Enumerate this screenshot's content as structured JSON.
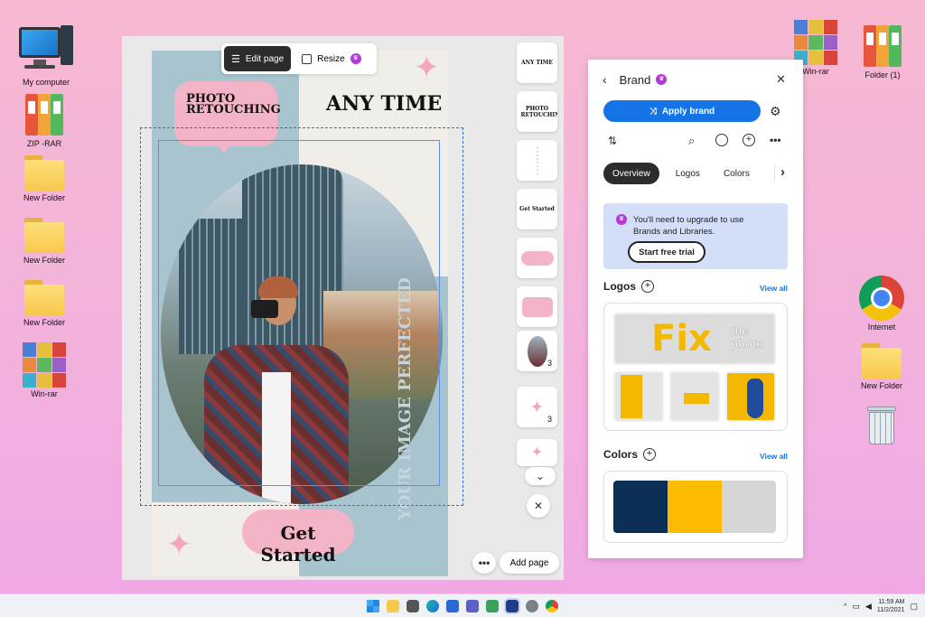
{
  "desktop": {
    "left_icons": [
      {
        "label": "My computer",
        "type": "computer"
      },
      {
        "label": "ZIP -RAR",
        "type": "binders"
      },
      {
        "label": "New Folder",
        "type": "folder"
      },
      {
        "label": "New Folder",
        "type": "folder"
      },
      {
        "label": "New Folder",
        "type": "folder"
      },
      {
        "label": "Win-rar",
        "type": "winrar"
      }
    ],
    "right_icons": [
      {
        "label": "Win-rar",
        "type": "winrar"
      },
      {
        "label": "Folder (1)",
        "type": "binders"
      },
      {
        "label": "Internet",
        "type": "chrome"
      },
      {
        "label": "New Folder",
        "type": "folder"
      },
      {
        "label": "",
        "type": "recycle-bin"
      }
    ]
  },
  "editor": {
    "toolbar": {
      "edit_page": "Edit page",
      "resize": "Resize"
    },
    "canvas": {
      "photo_retouching": "PHOTO RETOUCHING",
      "any_time": "ANY TIME",
      "get_started": "Get Started",
      "vertical_text": "YOUR IMAGE PERFECTED"
    },
    "thumbnails": [
      {
        "label": "ANY TIME",
        "count": ""
      },
      {
        "label": "PHOTO RETOUCHING",
        "count": ""
      },
      {
        "label": "",
        "count": ""
      },
      {
        "label": "Get Started",
        "count": ""
      },
      {
        "label": "",
        "count": ""
      },
      {
        "label": "",
        "count": ""
      },
      {
        "label": "",
        "count": "3"
      },
      {
        "label": "",
        "count": "3"
      },
      {
        "label": "",
        "count": ""
      }
    ],
    "add_page": "Add page",
    "more_icon": "more-icon"
  },
  "brand_panel": {
    "title": "Brand",
    "apply_brand": "Apply brand",
    "tabs": [
      "Overview",
      "Logos",
      "Colors"
    ],
    "upgrade_text": "You'll need to upgrade to use Brands and Libraries.",
    "start_trial": "Start free trial",
    "logos_title": "Logos",
    "colors_title": "Colors",
    "view_all": "View all",
    "logo_main": {
      "big": "Fix",
      "small": "the photo"
    },
    "colors": [
      "#0b2e55",
      "#fdbb00",
      "#d6d6d6"
    ]
  },
  "taskbar": {
    "time": "11:59 AM",
    "date": "11/2/2021"
  },
  "colors": {
    "accent": "#1473e6",
    "pink": "#f4b4c8",
    "premium": "#b03bd6"
  }
}
